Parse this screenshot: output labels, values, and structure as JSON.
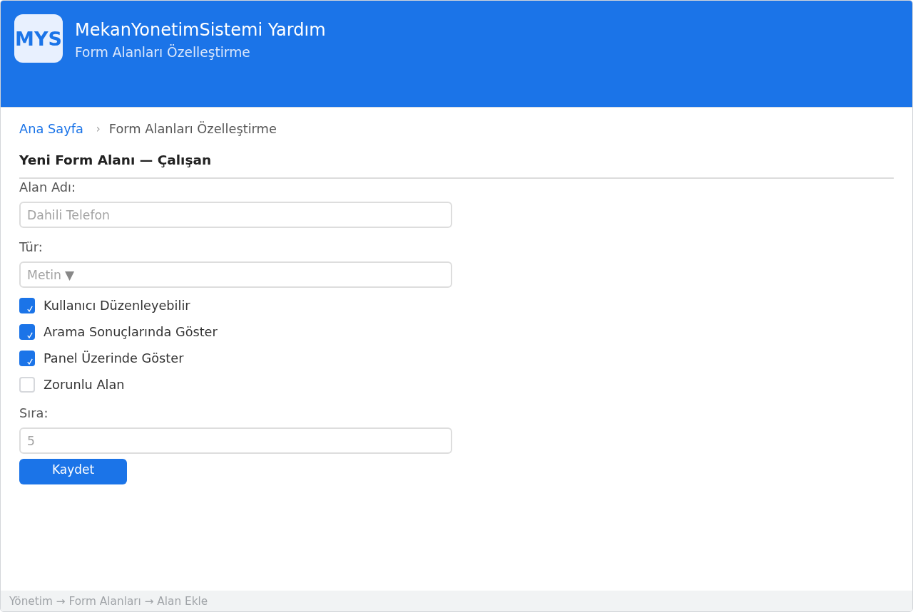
{
  "header": {
    "logo": "MYS",
    "title": "MekanYonetimSistemi Yardım",
    "subtitle": "Form Alanları Özelleştirme"
  },
  "breadcrumb": {
    "separator": "›",
    "items": [
      {
        "kind": "link",
        "label": "Ana Sayfa"
      },
      {
        "kind": "current",
        "label": "Form Alanları Özelleştirme"
      }
    ]
  },
  "form": {
    "title": "Yeni Form Alanı — Çalışan",
    "items": [
      {
        "kind": "text",
        "label": "Alan Adı:",
        "placeholder": "Dahili Telefon"
      },
      {
        "kind": "select",
        "label": "Tür:",
        "placeholder": "Metin",
        "caret": "▼"
      },
      {
        "kind": "checkbox",
        "label": "Kullanıcı Düzenleyebilir",
        "checked": true
      },
      {
        "kind": "checkbox",
        "label": "Arama Sonuçlarında Göster",
        "checked": true
      },
      {
        "kind": "checkbox",
        "label": "Panel Üzerinde Göster",
        "checked": true
      },
      {
        "kind": "checkbox",
        "label": "Zorunlu Alan",
        "checked": false
      },
      {
        "kind": "number",
        "label": "Sıra:",
        "placeholder": "5"
      }
    ],
    "submit": "Kaydet"
  },
  "status_bar": {
    "path": "Yönetim → Form Alanları → Alan Ekle"
  }
}
